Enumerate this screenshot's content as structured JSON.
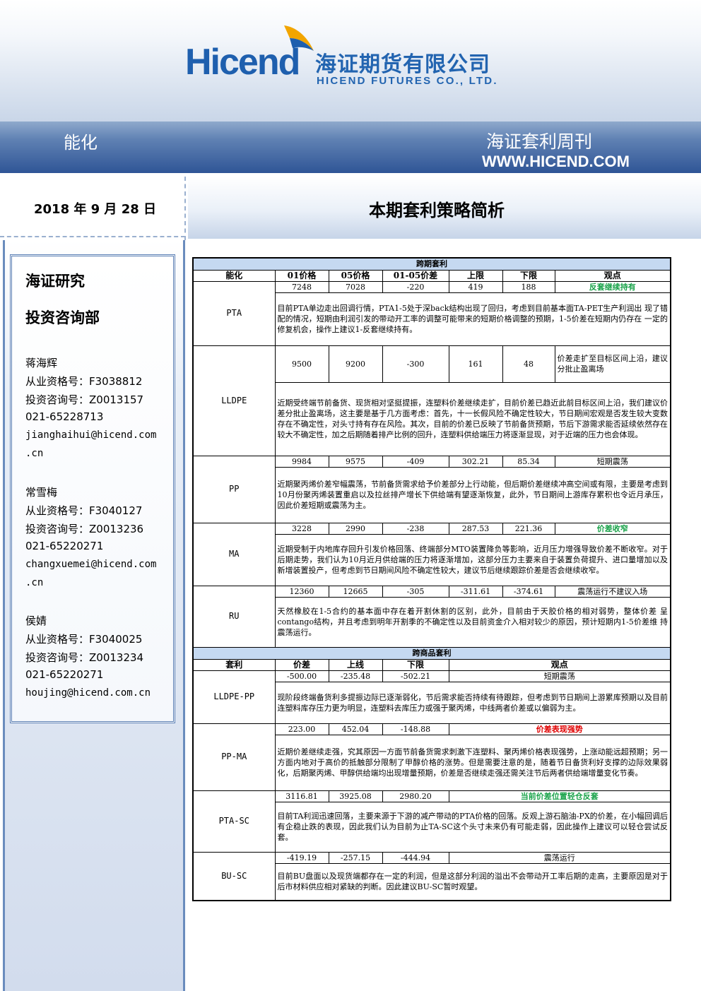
{
  "header": {
    "logo_text": "Hicend",
    "company_cn": "海证期货有限公司",
    "company_en": "HICEND  FUTURES  CO.,  LTD.",
    "section": "能化",
    "publication": "海证套利周刊",
    "website": "WWW.HICEND.COM",
    "brand_color": "#1e5fae",
    "band_color": "#2f5596"
  },
  "date": "2018 年 9 月 28 日",
  "report_title": "本期套利策略简析",
  "sidebar": {
    "org": "海证研究",
    "dept": "投资咨询部",
    "analysts": [
      {
        "name": "蒋海辉",
        "license": "从业资格号：F3038812",
        "advisory": "投资咨询号：Z0013157",
        "phone": "021-65228713",
        "email1": "jianghaihui@hicend.com",
        "email2": ".cn"
      },
      {
        "name": "常雪梅",
        "license": "从业资格号：F3040127",
        "advisory": "投资咨询号：Z0013236",
        "phone": "021-65220271",
        "email1": "changxuemei@hicend.com",
        "email2": ".cn"
      },
      {
        "name": "侯婧",
        "license": "从业资格号：F3040025",
        "advisory": "投资咨询号：Z0013234",
        "phone": "021-65220271",
        "email1": "houjing@hicend.com.cn"
      }
    ]
  },
  "table": {
    "intertemporal": {
      "section": "跨期套利",
      "headers": [
        "能化",
        "01价格",
        "05价格",
        "01-05价差",
        "上限",
        "下限",
        "观点"
      ],
      "rows": [
        {
          "name": "PTA",
          "p01": "7248",
          "p05": "7028",
          "spread": "-220",
          "upper": "419",
          "lower": "188",
          "view": "反套继续持有",
          "comment": "目前PTA单边走出回调行情，PTA1-5处于深back结构出现了回归，考虑到目前基本面TA-PET生产利润出 现了错配的情况，短期由利润引发的带动开工率的调整可能带来的短期价格调整的预期，1-5价差在短期内仍存在 一定的修复机会，操作上建议1-反套继续持有。"
        },
        {
          "name": "LLDPE",
          "p01": "9500",
          "p05": "9200",
          "spread": "-300",
          "upper": "161",
          "lower": "48",
          "view": "价差走扩至目标区间上沿，建议分批止盈离场",
          "comment": "近期受终端节前备货、现货相对坚挺提振，连塑料价差继续走扩，目前价差已趋近此前目标区间上沿，我们建议价差分批止盈离场，这主要是基于几方面考虑：首先，十一长假风险不确定性较大，节日期间宏观是否发生较大变数存在不确定性，对头寸持有存在风险。其次，目前的价差已反映了节前备货预期，节后下游需求能否延续依然存在较大不确定性，加之后期随着排产比例的回升，连塑料供给端压力将逐渐显现，对于近端的压力也会体现。"
        },
        {
          "name": "PP",
          "p01": "9984",
          "p05": "9575",
          "spread": "-409",
          "upper": "302.21",
          "lower": "85.34",
          "view": "短期震荡",
          "comment": "近期聚丙烯价差窄幅震荡，节前备货需求给予价差部分上行动能，但后期价差继续冲高空间或有限，主要是考虑到10月份聚丙烯装置重启以及拉丝排产增长下供给端有望逐渐恢复，此外，节日期间上游库存累积也令近月承压，因此价差短期或震荡为主。"
        },
        {
          "name": "MA",
          "p01": "3228",
          "p05": "2990",
          "spread": "-238",
          "upper": "287.53",
          "lower": "221.36",
          "view": "价差收窄",
          "comment": "近期受制于内地库存回升引发价格回落、终端部分MTO装置降负等影响，近月压力增强导致价差不断收窄。对于后期走势，我们认为10月近月供给端的压力将逐渐增加，这部分压力主要来自于装置负荷提升、进口量增加以及新增装置投产，但考虑到节日期间风险不确定性较大，建议节后继续跟踪价差是否会继续收窄。"
        },
        {
          "name": "RU",
          "p01": "12360",
          "p05": "12665",
          "spread": "-305",
          "upper": "-311.61",
          "lower": "-374.61",
          "view": "震荡运行不建议入场",
          "comment": "天然橡胶在1-5合约的基本面中存在着开割休割的区别，此外，目前由于天胶价格的相对弱势，整体价差 呈contango结构，并且考虑到明年开割季的不确定性以及目前资金介入相对较少的原因，预计短期内1-5价差维 持震荡运行。"
        }
      ]
    },
    "intercommodity": {
      "section": "跨商品套利",
      "headers": [
        "套利",
        "价差",
        "上线",
        "下限",
        "观点"
      ],
      "rows": [
        {
          "name": "LLDPE-PP",
          "spread": "-500.00",
          "upper": "-235.48",
          "lower": "-502.21",
          "view": "短期震荡",
          "comment": "现阶段终端备货利多提振边际已逐渐弱化，节后需求能否持续有待跟踪，但考虑到节日期间上游累库预期以及目前连塑料库存压力更为明显，连塑料去库压力或强于聚丙烯，中线两者价差或以偏弱为主。"
        },
        {
          "name": "PP-MA",
          "spread": "223.00",
          "upper": "452.04",
          "lower": "-148.88",
          "view": "价差表现强势",
          "comment": "近期价差继续走强，究其原因一方面节前备货需求刺激下连塑料、聚丙烯价格表现强势，上涨动能远超预期；另一方面内地对于高价的抵触部分限制了甲醇价格的涨势。但是需要注意的是，随着节日备货利好支撑的边际效果弱化，后期聚丙烯、甲醇供给端均出现增量预期，价差是否继续走强还需关注节后两者供给端增量变化节奏。"
        },
        {
          "name": "PTA-SC",
          "spread": "3116.81",
          "upper": "3925.08",
          "lower": "2980.20",
          "view": "当前价差位置轻仓反套",
          "comment": "目前TA利润迅速回落，主要来源于下游的减产带动的PTA价格的回落。反观上游石脑油-PX的价差，在小幅回调后有企稳止跌的表现，因此我们认为目前为止TA-SC这个头寸未来仍有可能走弱，因此操作上建议可以轻仓尝试反套。"
        },
        {
          "name": "BU-SC",
          "spread": "-419.19",
          "upper": "-257.15",
          "lower": "-444.94",
          "view": "震荡运行",
          "comment": "目前BU盘面以及现货端都存在一定的利润，但是这部分利润的溢出不会带动开工率后期的走高，主要原因是对于后市材料供应相对紧缺的判断。因此建议BU-SC暂时观望。"
        }
      ]
    }
  }
}
